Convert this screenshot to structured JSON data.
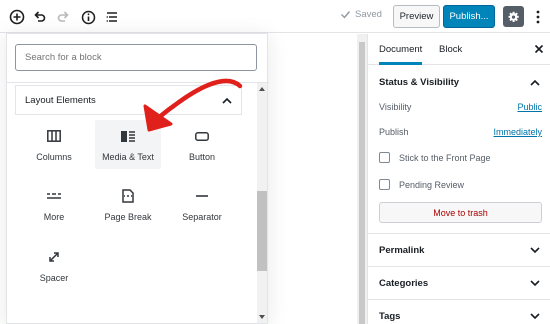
{
  "toolbar": {
    "add_icon": "plus-circle-icon",
    "undo_icon": "undo-icon",
    "redo_icon": "redo-icon",
    "info_icon": "info-icon",
    "outline_icon": "list-view-icon",
    "saved_label": "Saved",
    "preview_label": "Preview",
    "publish_label": "Publish...",
    "settings_icon": "gear-icon",
    "more_icon": "vertical-ellipsis-icon"
  },
  "inserter": {
    "search_placeholder": "Search for a block",
    "panel_title": "Layout Elements",
    "blocks": [
      {
        "label": "Columns",
        "icon": "columns-icon"
      },
      {
        "label": "Media & Text",
        "icon": "media-text-icon"
      },
      {
        "label": "Button",
        "icon": "button-icon"
      },
      {
        "label": "More",
        "icon": "more-icon"
      },
      {
        "label": "Page Break",
        "icon": "page-break-icon"
      },
      {
        "label": "Separator",
        "icon": "separator-icon"
      },
      {
        "label": "Spacer",
        "icon": "spacer-icon"
      }
    ]
  },
  "sidebar": {
    "tabs": [
      {
        "label": "Document",
        "active": true
      },
      {
        "label": "Block",
        "active": false
      }
    ],
    "status": {
      "title": "Status & Visibility",
      "visibility_label": "Visibility",
      "visibility_value": "Public",
      "publish_label": "Publish",
      "publish_value": "Immediately",
      "stick_label": "Stick to the Front Page",
      "pending_label": "Pending Review",
      "trash_label": "Move to trash"
    },
    "sections": [
      {
        "title": "Permalink"
      },
      {
        "title": "Categories"
      },
      {
        "title": "Tags"
      }
    ]
  },
  "colors": {
    "accent": "#0085ba",
    "annotation": "#e0201b",
    "trash_text": "#aa0000"
  }
}
